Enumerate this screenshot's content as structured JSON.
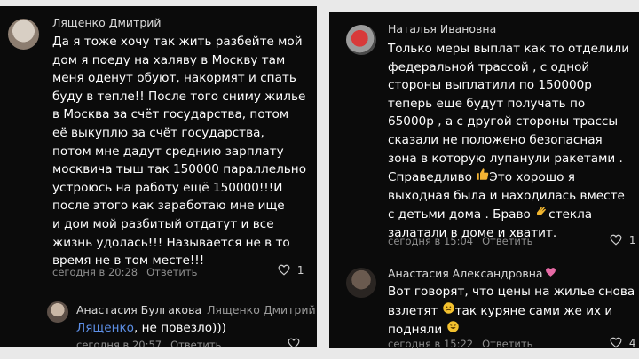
{
  "left_panel": {
    "comment1": {
      "author": "Лященко Дмитрий",
      "lines": [
        "Да я тоже хочу так жить разбейте мой",
        "дом я поеду на халяву в Москву там",
        "меня оденут обуют, накормят и спать",
        "буду в тепле!! После того сниму жилье",
        "в Москва за счёт государства, потом",
        "её выкуплю за счёт государства,",
        "потом мне дадут среднию зарплату",
        "москвича тыш так 150000 параллельно",
        "устроюсь на работу ещё 150000!!!И",
        "после этого как заработаю мне ище",
        "и дом мой разбитый отдатут и все",
        "жизнь удолась!!! Называется не в то",
        "время не в том месте!!!"
      ],
      "time": "сегодня в 20:28",
      "reply_label": "Ответить",
      "likes": "1"
    },
    "comment2": {
      "author": "Анастасия Булгакова",
      "reply_to": "Лященко Дмитрий",
      "mention": "Лященко",
      "text_after_mention": ", не повезло)))",
      "time": "сегодня в 20:57",
      "reply_label": "Ответить"
    }
  },
  "right_panel": {
    "comment1": {
      "author": "Наталья Ивановна",
      "lines": [
        "Только меры выплат как то отделили",
        "федеральной трассой , с одной",
        "стороны выплатили  по 150000р",
        "теперь еще будут получать по",
        "65000р , а с другой стороны  трассы",
        "сказали не положено  безопасная",
        "зона  в которую лупанули ракетами .",
        "Справедливо"
      ],
      "line8_after_emoji": "Это хорошо я",
      "line9": "выходная была и находилась вместе",
      "line10_before_emoji": "с детьми дома . Браво",
      "line10_after_emoji": "стекла",
      "line11": "залатали в доме и хватит.",
      "time": "сегодня в 15:04",
      "reply_label": "Ответить",
      "likes": "1"
    },
    "comment2": {
      "author": "Анастасия Александровна",
      "line1": "Вот говорят, что цены на жилье снова",
      "line2_before_emoji": "взлетят",
      "line2_after_emoji": "так куряне сами же их и",
      "line3": "подняли",
      "time": "сегодня в 15:22",
      "reply_label": "Ответить",
      "likes": "4"
    }
  },
  "icons": {
    "heart_color": "#cfcfcf",
    "thumbs_up_color": "#f2b233",
    "clap_color": "#f0b52f",
    "thinking_color": "#f3c12e",
    "laugh_color": "#f3c12e",
    "heart_pink": "#e66aa5"
  }
}
